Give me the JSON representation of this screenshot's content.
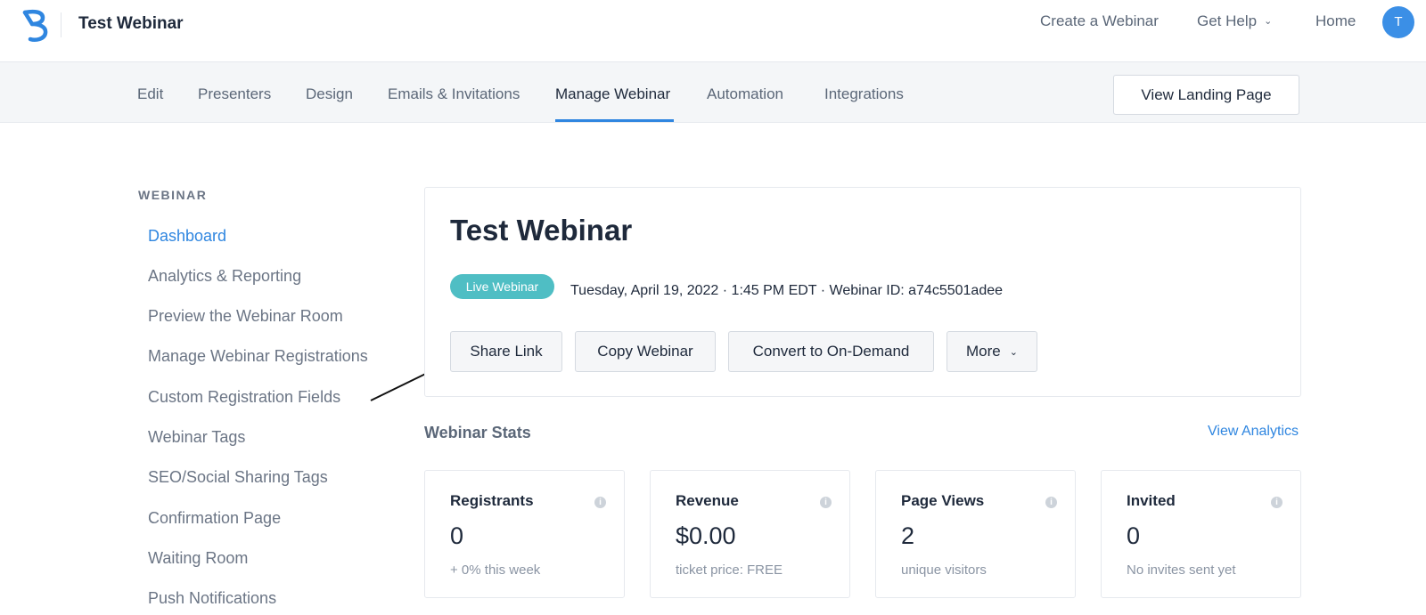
{
  "header": {
    "app_title": "Test Webinar",
    "logo_icon": "brand-b-logo",
    "links": {
      "create": "Create a Webinar",
      "help": "Get Help",
      "home": "Home"
    },
    "avatar_initial": "T"
  },
  "tabs": {
    "edit": "Edit",
    "presenters": "Presenters",
    "design": "Design",
    "emails": "Emails & Invitations",
    "manage": "Manage Webinar",
    "automation": "Automation",
    "integrations": "Integrations",
    "active": "Manage Webinar",
    "view_landing": "View Landing Page"
  },
  "sidebar": {
    "heading": "WEBINAR",
    "items": [
      {
        "label": "Dashboard",
        "active": true
      },
      {
        "label": "Analytics & Reporting"
      },
      {
        "label": "Preview the Webinar Room"
      },
      {
        "label": "Manage Webinar Registrations"
      },
      {
        "label": "Custom Registration Fields"
      },
      {
        "label": "Webinar Tags"
      },
      {
        "label": "SEO/Social Sharing Tags"
      },
      {
        "label": "Confirmation Page"
      },
      {
        "label": "Waiting Room"
      },
      {
        "label": "Push Notifications"
      }
    ]
  },
  "main": {
    "title": "Test Webinar",
    "badge": "Live Webinar",
    "meta": "Tuesday, April 19, 2022 · 1:45 PM EDT · Webinar ID: a74c5501adee",
    "buttons": {
      "share": "Share Link",
      "copy": "Copy Webinar",
      "convert": "Convert to On-Demand",
      "more": "More"
    }
  },
  "stats": {
    "heading": "Webinar Stats",
    "view_analytics": "View Analytics",
    "cards": [
      {
        "label": "Registrants",
        "value": "0",
        "sub": "+ 0% this week"
      },
      {
        "label": "Revenue",
        "value": "$0.00",
        "sub": "ticket price: FREE"
      },
      {
        "label": "Page Views",
        "value": "2",
        "sub": "unique visitors"
      },
      {
        "label": "Invited",
        "value": "0",
        "sub": "No invites sent yet"
      }
    ]
  },
  "colors": {
    "accent": "#2f86e0",
    "badge": "#4fbec4",
    "avatar": "#3b8fe6"
  }
}
